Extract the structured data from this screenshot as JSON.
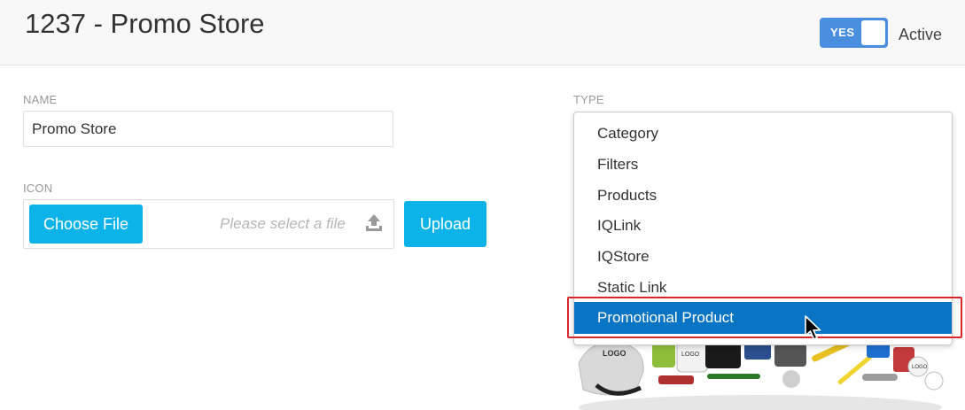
{
  "header": {
    "title": "1237 - Promo Store",
    "toggle_label": "YES",
    "status_label": "Active"
  },
  "form": {
    "name_label": "NAME",
    "name_value": "Promo Store",
    "icon_label": "ICON",
    "choose_file_label": "Choose File",
    "file_placeholder": "Please select a file",
    "upload_label": "Upload",
    "type_label": "TYPE"
  },
  "type_dropdown": {
    "options": [
      "Category",
      "Filters",
      "Products",
      "IQLink",
      "IQStore",
      "Static Link",
      "Promotional Product"
    ],
    "selected": "Promotional Product"
  },
  "icons": {
    "upload": "upload-icon",
    "cursor": "mouse-pointer-icon"
  },
  "colors": {
    "accent": "#0bb3e8",
    "toggle": "#4a8ee0",
    "selected_option": "#0a74c4",
    "highlight": "#d9262d"
  }
}
